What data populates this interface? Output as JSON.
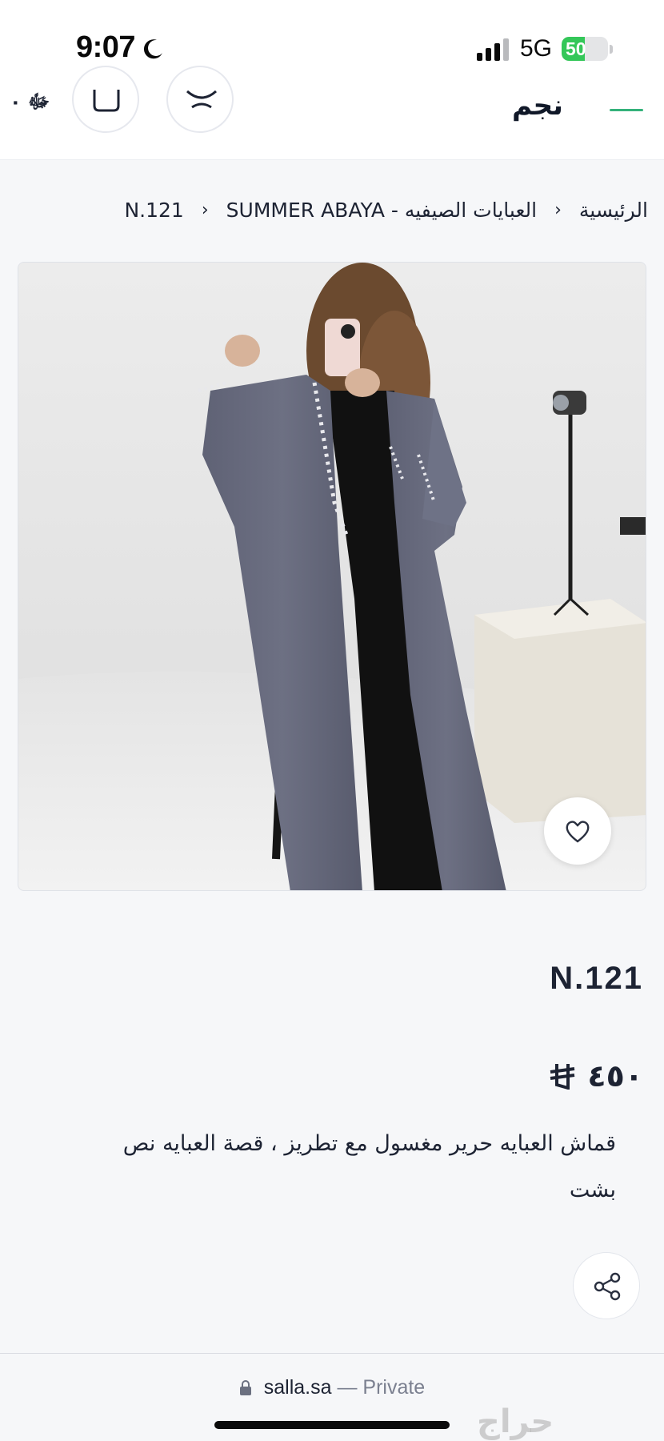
{
  "status_bar": {
    "time": "9:07",
    "network": "5G",
    "battery_label": "50",
    "battery_level": 0.5
  },
  "header": {
    "logo_text": "نجم",
    "cart_label": "ﷻ ٠",
    "accent_color": "#34b27b"
  },
  "breadcrumb": {
    "home": "الرئيسية",
    "category": "العبايات الصيفيه - SUMMER ABAYA",
    "current": "N.121"
  },
  "product": {
    "title": "N.121",
    "price": "٤٥٠",
    "description": "قماش العبايه حرير مغسول مع تطريز ، قصة العبايه نص بشت"
  },
  "browser": {
    "domain": "salla.sa",
    "separator": " — ",
    "mode": "Private"
  },
  "watermark": "حراج"
}
